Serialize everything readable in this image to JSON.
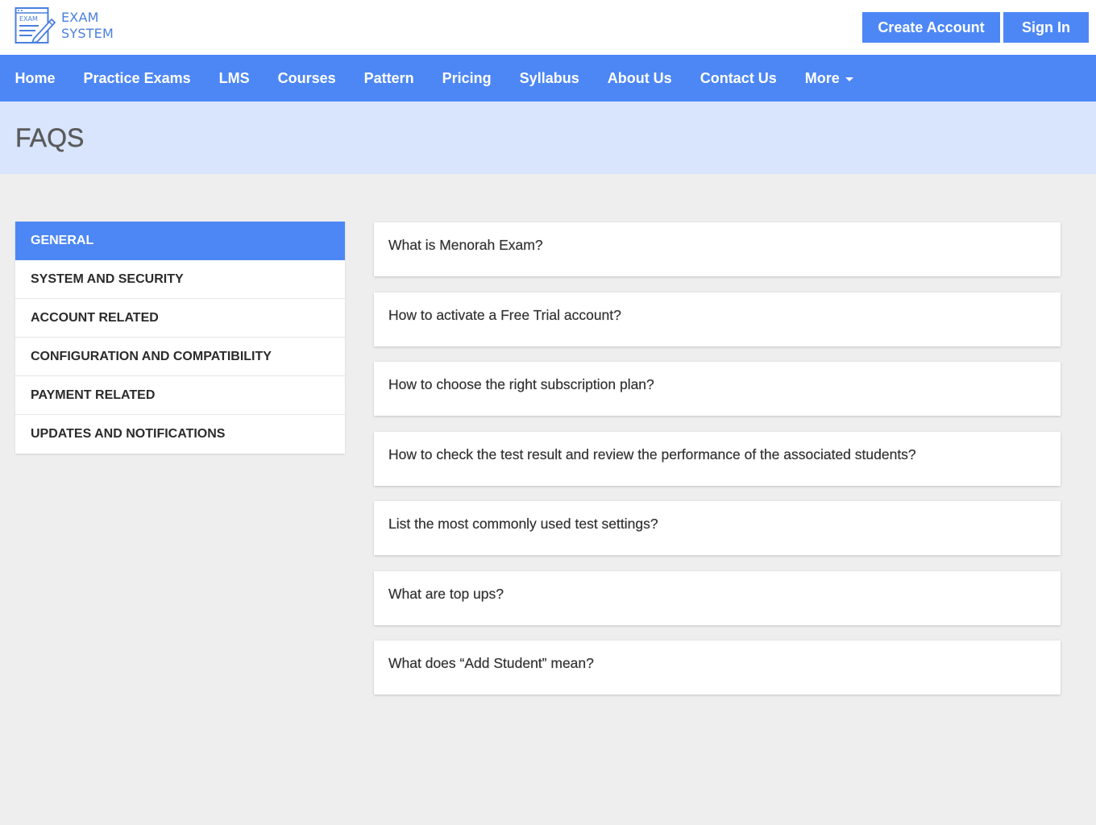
{
  "header": {
    "logo": {
      "line1": "EXAM",
      "line2": "SYSTEM",
      "mark_word": "EXAM",
      "icon": "exam-document-pencil-icon"
    },
    "create_account_label": "Create Account",
    "sign_in_label": "Sign In"
  },
  "nav": {
    "items": [
      {
        "label": "Home"
      },
      {
        "label": "Practice Exams"
      },
      {
        "label": "LMS"
      },
      {
        "label": "Courses"
      },
      {
        "label": "Pattern"
      },
      {
        "label": "Pricing"
      },
      {
        "label": "Syllabus"
      },
      {
        "label": "About Us"
      },
      {
        "label": "Contact Us"
      },
      {
        "label": "More",
        "icon": "caret-down-icon"
      }
    ]
  },
  "page": {
    "title": "FAQS"
  },
  "categories": {
    "active_index": 0,
    "items": [
      {
        "label": "GENERAL"
      },
      {
        "label": "SYSTEM AND SECURITY"
      },
      {
        "label": "ACCOUNT RELATED"
      },
      {
        "label": "CONFIGURATION AND COMPATIBILITY"
      },
      {
        "label": "PAYMENT RELATED"
      },
      {
        "label": "UPDATES AND NOTIFICATIONS"
      }
    ]
  },
  "faqs": {
    "items": [
      {
        "question": "What is Menorah Exam?"
      },
      {
        "question": "How to activate a Free Trial account?"
      },
      {
        "question": "How to choose the right subscription plan?"
      },
      {
        "question": "How to check the test result and review the performance of the associated students?"
      },
      {
        "question": "List the most commonly used test settings?"
      },
      {
        "question": "What are top ups?"
      },
      {
        "question": "What does “Add Student” mean?"
      }
    ]
  },
  "colors": {
    "brand_blue": "#4d87f5",
    "title_band": "#d8e5fc",
    "page_bg": "#eeeeee",
    "logo_blue": "#4a7fe0"
  }
}
